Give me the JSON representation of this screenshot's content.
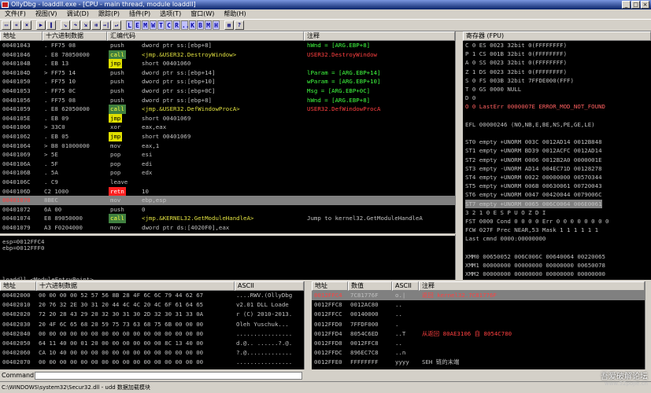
{
  "window": {
    "title": "OllyDbg - loaddll.exe - [CPU - main thread, module loaddll]"
  },
  "menu": [
    "文件(F)",
    "视图(V)",
    "调试(D)",
    "跟踪(P)",
    "插件(P)",
    "选项(T)",
    "窗口(W)",
    "帮助(H)"
  ],
  "toolbar": {
    "letters": [
      "L",
      "E",
      "M",
      "W",
      "T",
      "C",
      "R",
      "...",
      "K",
      "B",
      "M",
      "H"
    ]
  },
  "disasm": {
    "headers": {
      "addr": "地址",
      "hex": "十六进制数据",
      "asm": "汇编代码",
      "comment": "注释"
    },
    "rows": [
      {
        "addr": "00401043",
        "hex": ".  FF75 08",
        "op": "push",
        "opt": "",
        "arg": "dword ptr ss:[ebp+8]",
        "cm": "hWnd = [ARG.EBP+8]",
        "cmc": "grn"
      },
      {
        "addr": "00401046",
        "hex": ".  E8 78050000",
        "op": "call",
        "opt": "call",
        "arg": "<jmp.&USER32.DestroyWindow>",
        "cm": "USER32.DestroyWindow",
        "cmc": "red"
      },
      {
        "addr": "0040104B",
        "hex": ".  EB 13",
        "op": "jmp",
        "opt": "jmp",
        "arg": "short 00401060",
        "cm": "",
        "cmc": ""
      },
      {
        "addr": "0040104D",
        "hex": ">  FF75 14",
        "op": "push",
        "opt": "",
        "arg": "dword ptr ss:[ebp+14]",
        "cm": "lParam = [ARG.EBP+14]",
        "cmc": "grn"
      },
      {
        "addr": "00401050",
        "hex": ".  FF75 10",
        "op": "push",
        "opt": "",
        "arg": "dword ptr ss:[ebp+10]",
        "cm": "wParam = [ARG.EBP+10]",
        "cmc": "grn"
      },
      {
        "addr": "00401053",
        "hex": ".  FF75 0C",
        "op": "push",
        "opt": "",
        "arg": "dword ptr ss:[ebp+0C]",
        "cm": "Msg = [ARG.EBP+0C]",
        "cmc": "grn"
      },
      {
        "addr": "00401056",
        "hex": ".  FF75 08",
        "op": "push",
        "opt": "",
        "arg": "dword ptr ss:[ebp+8]",
        "cm": "hWnd = [ARG.EBP+8]",
        "cmc": "grn"
      },
      {
        "addr": "00401059",
        "hex": ".  E8 62050000",
        "op": "call",
        "opt": "call",
        "arg": "<jmp.&USER32.DefWindowProcA>",
        "cm": "USER32.DefWindowProcA",
        "cmc": "red"
      },
      {
        "addr": "0040105E",
        "hex": ".  EB 09",
        "op": "jmp",
        "opt": "jmp",
        "arg": "short 00401069",
        "cm": "",
        "cmc": ""
      },
      {
        "addr": "00401060",
        "hex": ">  33C0",
        "op": "xor",
        "opt": "",
        "arg": "eax,eax",
        "cm": "",
        "cmc": ""
      },
      {
        "addr": "00401062",
        "hex": ".  EB 05",
        "op": "jmp",
        "opt": "jmp",
        "arg": "short 00401069",
        "cm": "",
        "cmc": ""
      },
      {
        "addr": "00401064",
        "hex": ">  B8 01000000",
        "op": "mov",
        "opt": "",
        "arg": "eax,1",
        "cm": "",
        "cmc": ""
      },
      {
        "addr": "00401069",
        "hex": ">  5E",
        "op": "pop",
        "opt": "",
        "arg": "esi",
        "cm": "",
        "cmc": ""
      },
      {
        "addr": "0040106A",
        "hex": ".  5F",
        "op": "pop",
        "opt": "",
        "arg": "edi",
        "cm": "",
        "cmc": ""
      },
      {
        "addr": "0040106B",
        "hex": ".  5A",
        "op": "pop",
        "opt": "",
        "arg": "edx",
        "cm": "",
        "cmc": ""
      },
      {
        "addr": "0040106C",
        "hex": ".  C9",
        "op": "leave",
        "opt": "",
        "arg": "",
        "cm": "",
        "cmc": ""
      },
      {
        "addr": "0040106D",
        "hex": "   C2 1000",
        "op": "retn",
        "opt": "retn",
        "arg": "10",
        "cm": "",
        "cmc": ""
      },
      {
        "addr": "00401070",
        "hex": "   8BEC",
        "op": "mov",
        "opt": "",
        "arg": "ebp,esp",
        "cm": "",
        "cmc": "",
        "sel": true
      },
      {
        "addr": "00401072",
        "hex": "   6A 00",
        "op": "push",
        "opt": "",
        "arg": "0",
        "cm": "",
        "cmc": ""
      },
      {
        "addr": "00401074",
        "hex": "   E8 89050000",
        "op": "call",
        "opt": "call",
        "arg": "<jmp.&KERNEL32.GetModuleHandleA>",
        "cm": "Jump to kernel32.GetModuleHandleA",
        "cmc": ""
      },
      {
        "addr": "00401079",
        "hex": "   A3 F0204000",
        "op": "mov",
        "opt": "",
        "arg": "dword ptr ds:[4020F0],eax",
        "cm": "",
        "cmc": ""
      }
    ]
  },
  "info": {
    "lines": [
      "esp=0012FFC4",
      "ebp=0012FFF0",
      "",
      "",
      "",
      "",
      "loaddll.<ModuleEntryPoint>"
    ]
  },
  "registers": {
    "header": "寄存器 (FPU)",
    "lines": [
      "C 0  ES 0023 32bit 0(FFFFFFFF)",
      "P 1  CS 001B 32bit 0(FFFFFFFF)",
      "A 0  SS 0023 32bit 0(FFFFFFFF)",
      "Z 1  DS 0023 32bit 0(FFFFFFFF)",
      "S 0  FS 003B 32bit 7FFDE000(FFF)",
      "T 0  GS 0000 NULL",
      "D 0",
      "O 0  LastErr 0000007E ERROR_MOD_NOT_FOUND",
      "",
      "EFL 00000246 (NO,NB,E,BE,NS,PE,GE,LE)",
      "",
      "ST0 empty +UNORM 003C 0012AD14 0012B848",
      "ST1 empty +UNORM BD39 0012ACFC 0012AD14",
      "ST2 empty +UNORM 0006 0012B2A0 0000001E",
      "ST3 empty -UNORM AD14 004EC71D 00128278",
      "ST4 empty +UNORM 0022 00000000 00570344",
      "ST5 empty +UNORM 006B 00630061 00720043",
      "ST6 empty +UNORM 0047 00420044 0079006C",
      "ST7 empty +UNORM 0065 006C0064 006E0061",
      "              3 2 1 0      E S P U O Z D I",
      "FST 0000  Cond 0 0 0 0  Err 0 0 0 0 0 0 0 0",
      "FCW 027F  Prec NEAR,53  Mask    1 1 1 1 1 1",
      "Last cmnd 0000:00000000",
      "",
      "XMM0 00650052 006C006C 00640064 00220065",
      "XMM1 00000000 00000000 00000000 00650078",
      "XMM2 00000000 00000000 00000000 00000000"
    ]
  },
  "dump": {
    "headers": {
      "addr": "地址",
      "hex": "十六进制数据",
      "ascii": "ASCII"
    },
    "rows": [
      {
        "addr": "00402000",
        "hex": "00 00 00 00 52 57 56 8B 28 4F 6C 6C 79 44 62 67",
        "ascii": "....RWV.(OllyDbg"
      },
      {
        "addr": "00402010",
        "hex": "20 76 32 2E 30 31 20 44 4C 4C 20 4C 6F 61 64 65",
        "ascii": " v2.01 DLL Loade"
      },
      {
        "addr": "00402020",
        "hex": "72 20 28 43 29 20 32 30 31 30 2D 32 30 31 33 0A",
        "ascii": "r (C) 2010-2013."
      },
      {
        "addr": "00402030",
        "hex": "20 4F 6C 65 68 20 59 75 73 63 68 75 6B 00 00 00",
        "ascii": " Oleh Yuschuk..."
      },
      {
        "addr": "00402040",
        "hex": "00 00 00 00 00 00 00 00 00 00 00 00 00 00 00 00",
        "ascii": "................"
      },
      {
        "addr": "00402050",
        "hex": "64 11 40 00 01 20 00 00 00 00 00 00 8C 13 40 00",
        "ascii": "d.@.. ......?.@."
      },
      {
        "addr": "00402060",
        "hex": "CA 10 40 00 00 00 00 00 00 00 00 00 00 00 00 00",
        "ascii": "?.@............."
      },
      {
        "addr": "00402070",
        "hex": "00 00 00 00 00 00 00 00 00 00 00 00 00 00 00 00",
        "ascii": "................"
      }
    ]
  },
  "stack": {
    "headers": {
      "addr": "地址",
      "val": "数值",
      "ascii": "ASCII",
      "comment": "注释"
    },
    "rows": [
      {
        "addr": "0012FFC4",
        "val": "7C81776F",
        "ascii": "o.|",
        "cm": "返回 kernel32.7C81776F",
        "sel": true
      },
      {
        "addr": "0012FFC8",
        "val": "0012AC80",
        "ascii": "..",
        "cm": ""
      },
      {
        "addr": "0012FFCC",
        "val": "00140000",
        "ascii": "..",
        "cm": ""
      },
      {
        "addr": "0012FFD0",
        "val": "7FFDF000",
        "ascii": ".",
        "cm": ""
      },
      {
        "addr": "0012FFD4",
        "val": "8054C6ED",
        "ascii": "..T",
        "cm": "从返回 80AE3106 自 8054C780"
      },
      {
        "addr": "0012FFD8",
        "val": "0012FFC8",
        "ascii": "..",
        "cm": ""
      },
      {
        "addr": "0012FFDC",
        "val": "896EC7C8",
        "ascii": "..n",
        "cm": ""
      },
      {
        "addr": "0012FFE0",
        "val": "FFFFFFFF",
        "ascii": "yyyy",
        "cm": "SEH 链的末端"
      }
    ]
  },
  "command": {
    "label": "Command :"
  },
  "status": {
    "text": "C:\\WINDOWS\\system32\\Secur32.dll - udd 数据加载模块"
  },
  "watermark": {
    "line1": "吾爱破解论坛",
    "line2": "www.52pojie.cn"
  }
}
